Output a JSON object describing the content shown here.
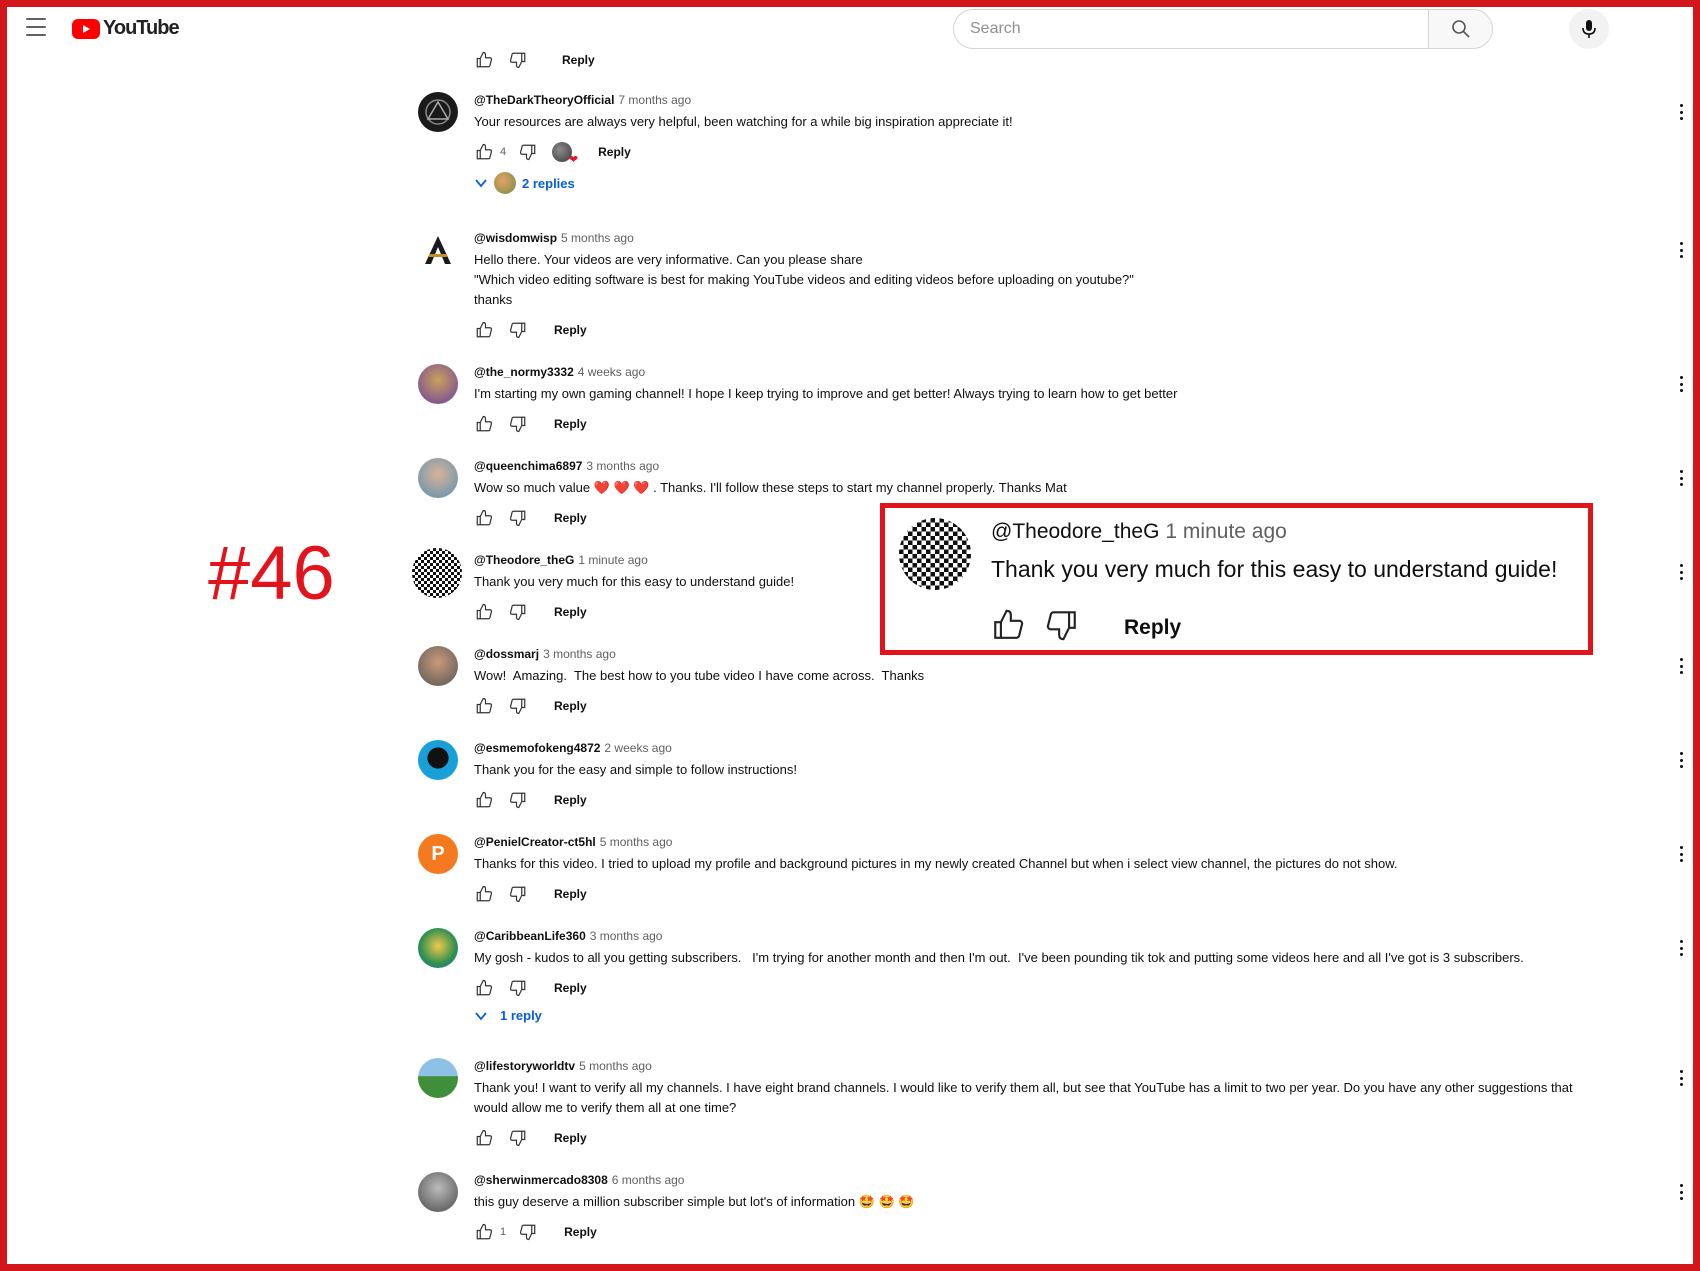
{
  "header": {
    "logo_text": "YouTube",
    "search_placeholder": "Search"
  },
  "top_actions": {
    "reply_label": "Reply"
  },
  "highlight_label": "#46",
  "comments": [
    {
      "author": "@TheDarkTheoryOfficial",
      "time": "7 months ago",
      "text": "Your resources are always very helpful, been watching for a while big inspiration appreciate it!",
      "likes": "4",
      "reply_label": "Reply",
      "replies": "2 replies"
    },
    {
      "author": "@wisdomwisp",
      "time": "5 months ago",
      "text": "Hello there. Your videos are very informative. Can you please share\n\"Which video editing software is best for making YouTube videos and editing videos before uploading on youtube?\"\nthanks",
      "reply_label": "Reply"
    },
    {
      "author": "@the_normy3332",
      "time": "4 weeks ago",
      "text": "I'm starting my own gaming channel! I hope I keep trying to improve and get better! Always trying to learn how to get better",
      "reply_label": "Reply"
    },
    {
      "author": "@queenchima6897",
      "time": "3 months ago",
      "text": "Wow so much value ❤️ ❤️ ❤️ . Thanks. I'll follow these steps to start my channel properly. Thanks Mat",
      "reply_label": "Reply"
    },
    {
      "author": "@Theodore_theG",
      "time": "1 minute ago",
      "text": "Thank you very much for this easy to understand guide!",
      "reply_label": "Reply"
    },
    {
      "author": "@dossmarj",
      "time": "3 months ago",
      "text": "Wow!  Amazing.  The best how to you tube video I have come across.  Thanks",
      "reply_label": "Reply"
    },
    {
      "author": "@esmemofokeng4872",
      "time": "2 weeks ago",
      "text": "Thank you for the easy and simple to follow instructions!",
      "reply_label": "Reply"
    },
    {
      "author": "@PenielCreator-ct5hl",
      "time": "5 months ago",
      "text": "Thanks for this video. I tried to upload my profile and background pictures in my newly created Channel but when i select view channel, the pictures do not show.",
      "reply_label": "Reply",
      "avatar_letter": "P"
    },
    {
      "author": "@CaribbeanLife360",
      "time": "3 months ago",
      "text": "My gosh - kudos to all you getting subscribers.   I'm trying for another month and then I'm out.  I've been pounding tik tok and putting some videos here and all I've got is 3 subscribers.",
      "reply_label": "Reply",
      "replies": "1 reply"
    },
    {
      "author": "@lifestoryworldtv",
      "time": "5 months ago",
      "text": "Thank you! I want to verify all my channels. I have eight brand channels. I would like to verify them all, but see that YouTube has a limit to two per year. Do you have any other suggestions that\nwould allow me to verify them all at one time?",
      "reply_label": "Reply"
    },
    {
      "author": "@sherwinmercado8308",
      "time": "6 months ago",
      "text": "this guy deserve a million subscriber simple but lot's of information 🤩 🤩 🤩",
      "likes": "1",
      "reply_label": "Reply"
    }
  ],
  "zoom": {
    "author": "@Theodore_theG",
    "time": "1 minute ago",
    "text": "Thank you very much for this easy to understand guide!",
    "reply_label": "Reply"
  },
  "colors": {
    "frame": "#d3151c",
    "accent_link": "#065fd4",
    "brand_red": "#ff0000"
  }
}
